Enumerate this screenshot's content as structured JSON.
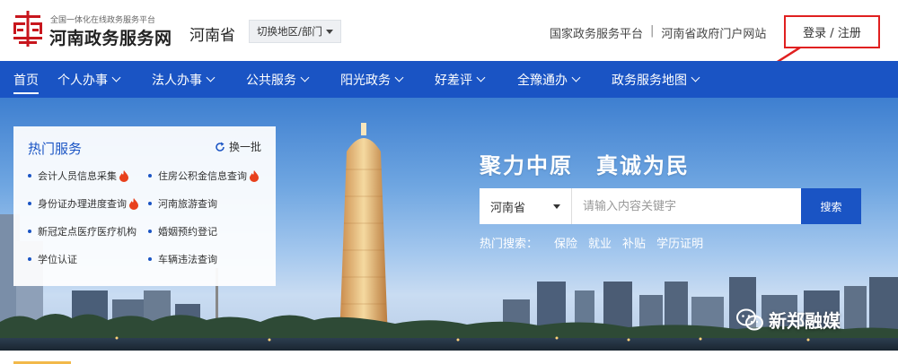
{
  "header": {
    "site_subtitle": "全国一体化在线政务服务平台",
    "site_name": "河南政务服务网",
    "province": "河南省",
    "region_switch": "切换地区/部门",
    "top_links": [
      "国家政务服务平台",
      "河南省政府门户网站"
    ],
    "link_separator": "|",
    "login": "登录 / 注册"
  },
  "nav": {
    "items": [
      {
        "label": "首页",
        "has_menu": false,
        "active": true
      },
      {
        "label": "个人办事",
        "has_menu": true
      },
      {
        "label": "法人办事",
        "has_menu": true
      },
      {
        "label": "公共服务",
        "has_menu": true
      },
      {
        "label": "阳光政务",
        "has_menu": true
      },
      {
        "label": "好差评",
        "has_menu": true
      },
      {
        "label": "全豫通办",
        "has_menu": true
      },
      {
        "label": "政务服务地图",
        "has_menu": true
      }
    ]
  },
  "hot_services": {
    "title": "热门服务",
    "refresh": "换一批",
    "items": [
      {
        "label": "会计人员信息采集",
        "hot": true
      },
      {
        "label": "住房公积金信息查询",
        "hot": true
      },
      {
        "label": "身份证办理进度查询",
        "hot": true
      },
      {
        "label": "河南旅游查询",
        "hot": false
      },
      {
        "label": "新冠定点医疗医疗机构",
        "hot": false
      },
      {
        "label": "婚姻预约登记",
        "hot": false
      },
      {
        "label": "学位认证",
        "hot": false
      },
      {
        "label": "车辆违法查询",
        "hot": false
      }
    ]
  },
  "hero": {
    "slogan": "聚力中原　真诚为民",
    "search_region": "河南省",
    "search_placeholder": "请输入内容关键字",
    "search_button": "搜索",
    "hot_search_label": "热门搜索：",
    "hot_search_terms": [
      "保险",
      "就业",
      "补贴",
      "学历证明"
    ]
  },
  "watermark": {
    "text": "新郑融媒"
  },
  "colors": {
    "brand_blue": "#1a54c4",
    "logo_red": "#c8161d",
    "annotation_red": "#e02020"
  }
}
